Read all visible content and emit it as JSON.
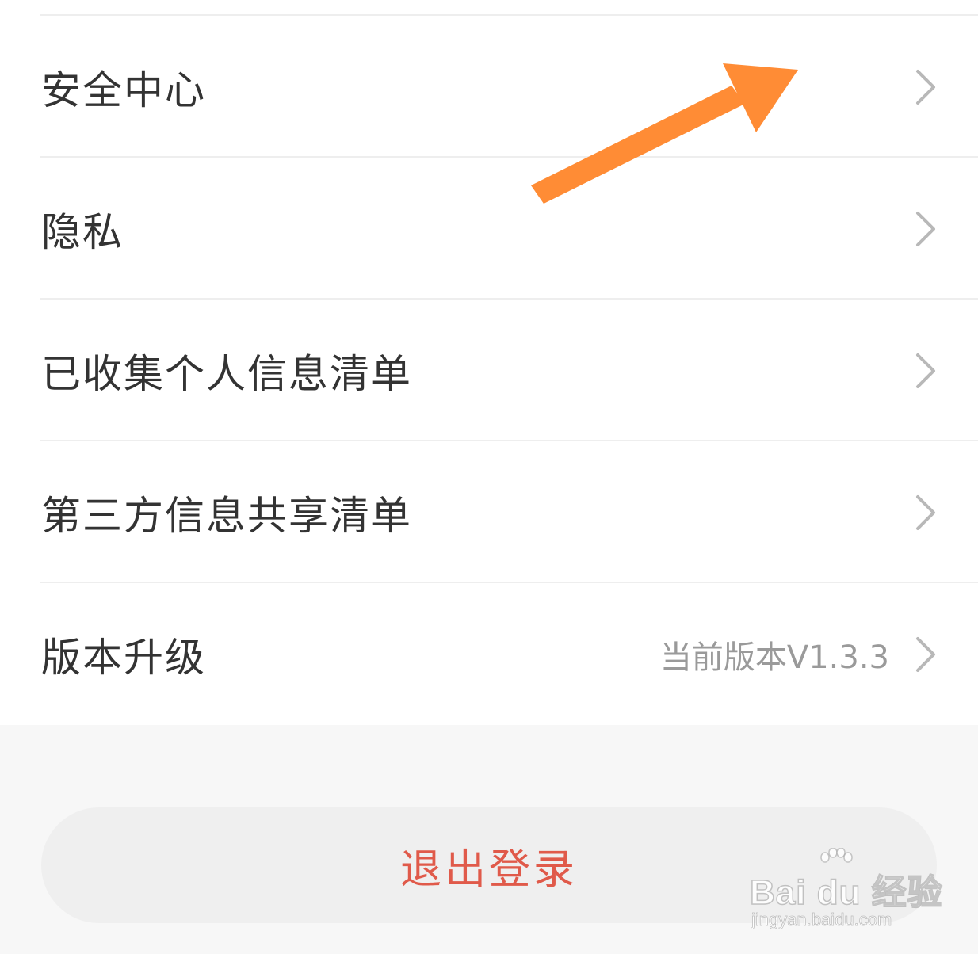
{
  "menu": {
    "items": [
      {
        "label": "安全中心"
      },
      {
        "label": "隐私"
      },
      {
        "label": "已收集个人信息清单"
      },
      {
        "label": "第三方信息共享清单"
      },
      {
        "label": "版本升级",
        "value": "当前版本V1.3.3"
      }
    ]
  },
  "logout": {
    "label": "退出登录"
  },
  "overlay": {
    "arrow_color": "#ff8c35"
  },
  "watermark": {
    "brand": "Bai du 经验",
    "url": "jingyan.baidu.com"
  },
  "icons": {
    "chevron": "chevron-right-icon"
  },
  "colors": {
    "text_primary": "#333333",
    "text_secondary": "#9a9a9a",
    "logout_text": "#e05a4a",
    "divider": "#eeeeee"
  }
}
